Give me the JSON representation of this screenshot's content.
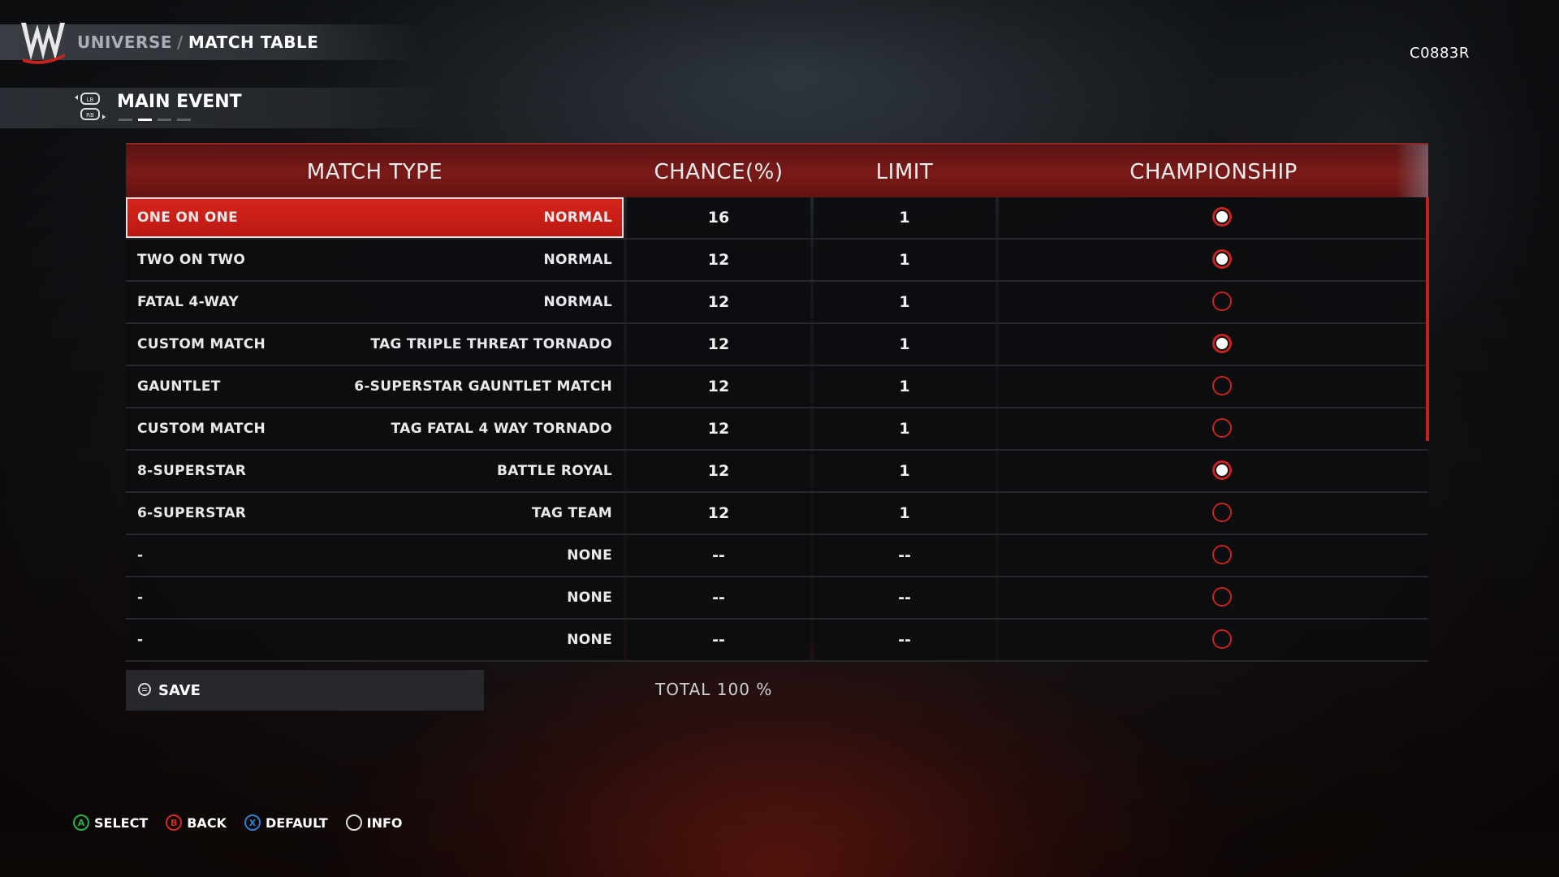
{
  "header": {
    "breadcrumb": [
      "UNIVERSE",
      "MATCH TABLE"
    ],
    "separator": "/",
    "user_id": "C0883R",
    "subtitle": "MAIN EVENT",
    "bumpers": {
      "left": "LB",
      "right": "RB"
    },
    "pages_total": 4,
    "page_current": 2
  },
  "table": {
    "columns": [
      "MATCH TYPE",
      "CHANCE(%)",
      "LIMIT",
      "CHAMPIONSHIP"
    ],
    "rows": [
      {
        "type": "ONE ON ONE",
        "variant": "NORMAL",
        "chance": "16",
        "limit": "1",
        "championship": true,
        "selected": true
      },
      {
        "type": "TWO ON TWO",
        "variant": "NORMAL",
        "chance": "12",
        "limit": "1",
        "championship": true
      },
      {
        "type": "FATAL 4-WAY",
        "variant": "NORMAL",
        "chance": "12",
        "limit": "1",
        "championship": false
      },
      {
        "type": "CUSTOM MATCH",
        "variant": "TAG TRIPLE THREAT TORNADO",
        "chance": "12",
        "limit": "1",
        "championship": true
      },
      {
        "type": "GAUNTLET",
        "variant": "6-SUPERSTAR GAUNTLET MATCH",
        "chance": "12",
        "limit": "1",
        "championship": false
      },
      {
        "type": "CUSTOM MATCH",
        "variant": "TAG FATAL 4 WAY TORNADO",
        "chance": "12",
        "limit": "1",
        "championship": false
      },
      {
        "type": "8-SUPERSTAR",
        "variant": "BATTLE ROYAL",
        "chance": "12",
        "limit": "1",
        "championship": true
      },
      {
        "type": "6-SUPERSTAR",
        "variant": "TAG TEAM",
        "chance": "12",
        "limit": "1",
        "championship": false
      },
      {
        "type": "-",
        "variant": "NONE",
        "chance": "--",
        "limit": "--",
        "championship": false
      },
      {
        "type": "-",
        "variant": "NONE",
        "chance": "--",
        "limit": "--",
        "championship": false
      },
      {
        "type": "-",
        "variant": "NONE",
        "chance": "--",
        "limit": "--",
        "championship": false
      }
    ]
  },
  "footer": {
    "save_label": "SAVE",
    "total_label": "TOTAL  100 %",
    "hints": [
      {
        "key": "A",
        "label": "SELECT",
        "color": "#1fb44a",
        "icon": "a-button-icon"
      },
      {
        "key": "B",
        "label": "BACK",
        "color": "#d8281e",
        "icon": "b-button-icon"
      },
      {
        "key": "X",
        "label": "DEFAULT",
        "color": "#2a7fd6",
        "icon": "x-button-icon"
      },
      {
        "key": "",
        "label": "INFO",
        "color": "#dddddd",
        "icon": "view-button-icon"
      }
    ]
  },
  "colors": {
    "accent": "#c8241d",
    "header_red": "#7a1a18",
    "cell_bg": "#0c0d0f"
  }
}
